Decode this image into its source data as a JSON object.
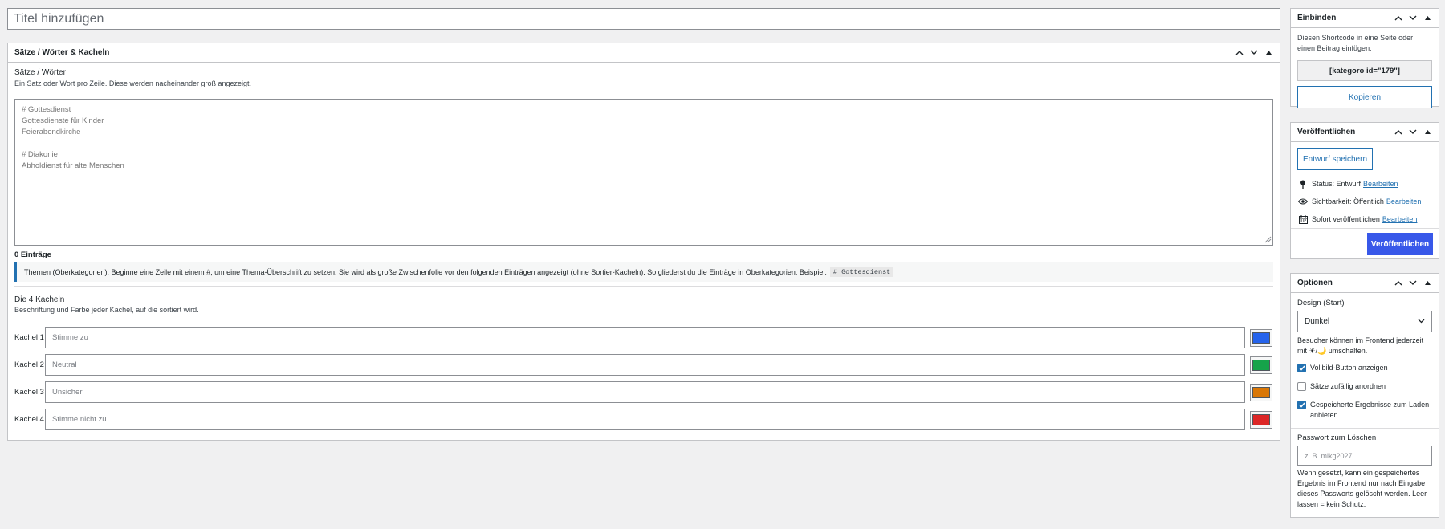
{
  "title_field": {
    "placeholder": "Titel hinzufügen"
  },
  "main_box": {
    "heading": "Sätze / Wörter & Kacheln",
    "sentences": {
      "label": "Sätze / Wörter",
      "hint": "Ein Satz oder Wort pro Zeile. Diese werden nacheinander groß angezeigt.",
      "placeholder": "# Gottesdienst\nGottesdienste für Kinder\nFeierabendkirche\n\n# Diakonie\nAbholdienst für alte Menschen"
    },
    "count": "0 Einträge",
    "notice_text": "Themen (Oberkategorien): Beginne eine Zeile mit einem #, um eine Thema-Überschrift zu setzen. Sie wird als große Zwischenfolie vor den folgenden Einträgen angezeigt (ohne Sortier-Kacheln). So gliederst du die Einträge in Oberkategorien. Beispiel:",
    "notice_code": "# Gottesdienst",
    "tiles_title": "Die 4 Kacheln",
    "tiles_hint": "Beschriftung und Farbe jeder Kachel, auf die sortiert wird.",
    "tiles": [
      {
        "label": "Kachel 1",
        "placeholder": "Stimme zu",
        "color": "#2563eb"
      },
      {
        "label": "Kachel 2",
        "placeholder": "Neutral",
        "color": "#16a34a"
      },
      {
        "label": "Kachel 3",
        "placeholder": "Unsicher",
        "color": "#d97706"
      },
      {
        "label": "Kachel 4",
        "placeholder": "Stimme nicht zu",
        "color": "#dc2626"
      }
    ]
  },
  "embed_box": {
    "heading": "Einbinden",
    "text": "Diesen Shortcode in eine Seite oder einen Beitrag einfügen:",
    "shortcode": "[kategoro id=\"179\"]",
    "copy_label": "Kopieren"
  },
  "publish_box": {
    "heading": "Veröffentlichen",
    "save_draft_label": "Entwurf speichern",
    "status_label": "Status: Entwurf",
    "visibility_label": "Sichtbarkeit: Öffentlich",
    "schedule_label": "Sofort veröffentlichen",
    "edit_label": "Bearbeiten",
    "publish_label": "Veröffentlichen"
  },
  "options_box": {
    "heading": "Optionen",
    "design_label": "Design (Start)",
    "design_value": "Dunkel",
    "design_hint": "Besucher können im Frontend jederzeit mit ☀/🌙 umschalten.",
    "checkboxes": [
      {
        "label": "Vollbild-Button anzeigen",
        "checked": true
      },
      {
        "label": "Sätze zufällig anordnen",
        "checked": false
      },
      {
        "label": "Gespeicherte Ergebnisse zum Laden anbieten",
        "checked": true
      }
    ],
    "password_label": "Passwort zum Löschen",
    "password_placeholder": "z. B. mlkg2027",
    "password_hint": "Wenn gesetzt, kann ein gespeichertes Ergebnis im Frontend nur nach Eingabe dieses Passworts gelöscht werden. Leer lassen = kein Schutz."
  },
  "icons": {
    "move_up": "chevron-up-icon",
    "move_down": "chevron-down-icon",
    "toggle": "triangle-up-icon",
    "status": "pin-icon",
    "visibility": "eye-icon",
    "schedule": "calendar-icon"
  }
}
